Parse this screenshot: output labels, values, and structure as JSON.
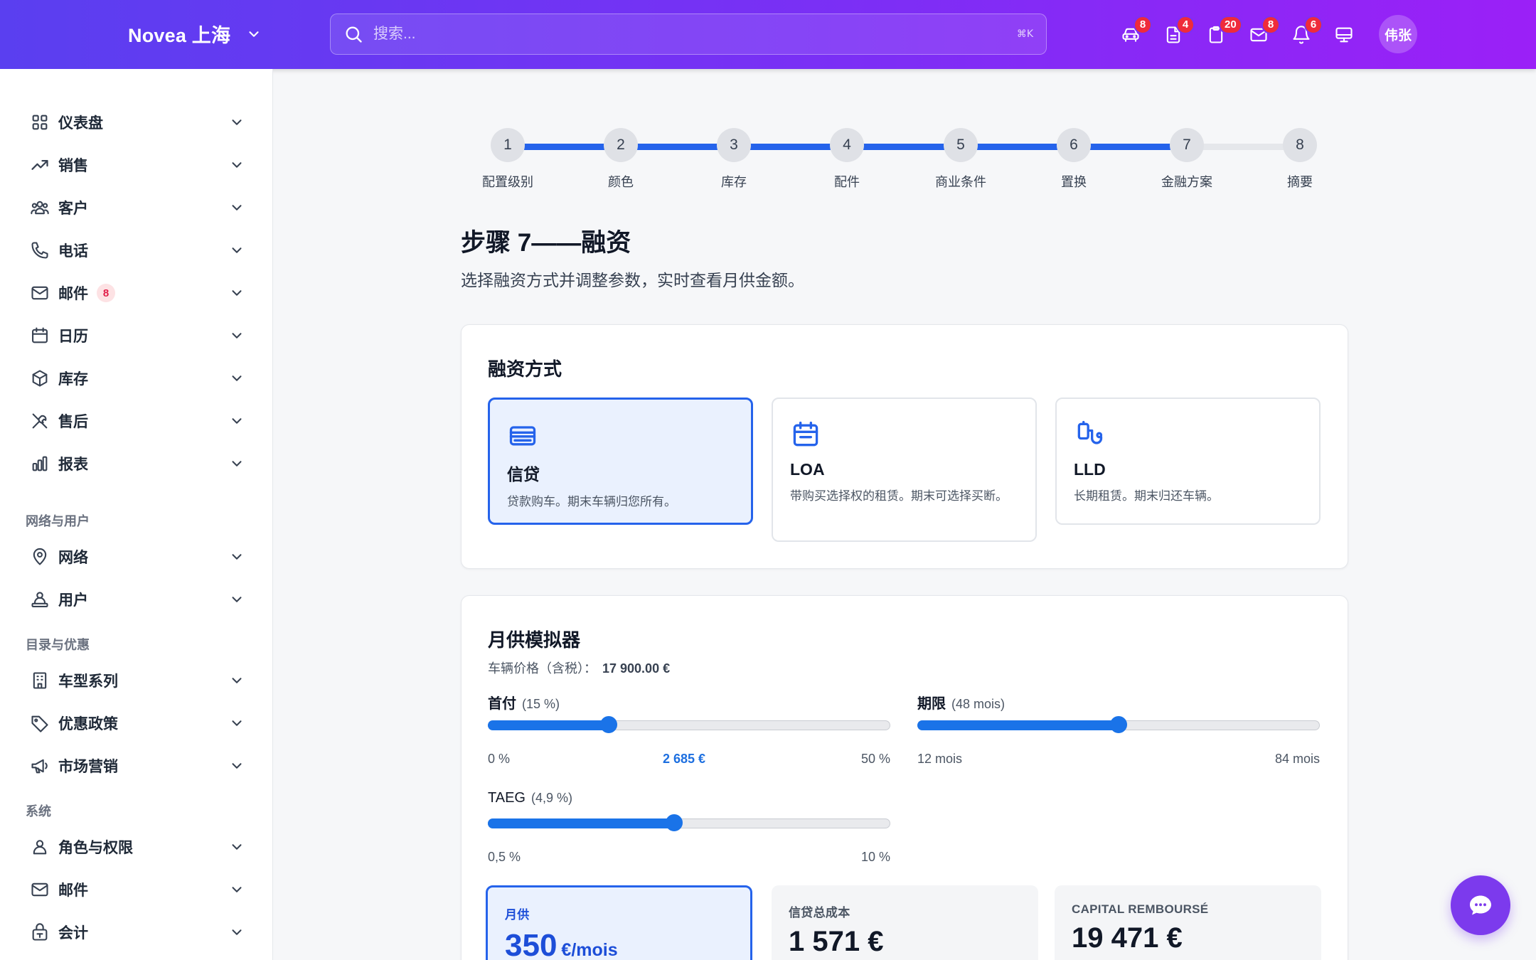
{
  "header": {
    "brand": "Novea 上海",
    "search_placeholder": "搜索...",
    "search_shortcut": "⌘K",
    "icons": [
      {
        "name": "car-icon",
        "badge": "8"
      },
      {
        "name": "document-icon",
        "badge": "4"
      },
      {
        "name": "clipboard-icon",
        "badge": "20"
      },
      {
        "name": "mail-icon",
        "badge": "8"
      },
      {
        "name": "bell-icon",
        "badge": "6"
      },
      {
        "name": "monitor-icon",
        "badge": ""
      }
    ],
    "avatar": "伟张"
  },
  "sidebar": {
    "items": [
      {
        "label": "仪表盘",
        "icon": "grid-icon"
      },
      {
        "label": "销售",
        "icon": "trending-up-icon"
      },
      {
        "label": "客户",
        "icon": "users-icon"
      },
      {
        "label": "电话",
        "icon": "phone-icon"
      },
      {
        "label": "邮件",
        "icon": "mail-icon",
        "badge": "8"
      },
      {
        "label": "日历",
        "icon": "calendar-icon"
      },
      {
        "label": "库存",
        "icon": "box-icon"
      },
      {
        "label": "售后",
        "icon": "tools-icon"
      },
      {
        "label": "报表",
        "icon": "bar-chart-icon"
      }
    ],
    "section_network": "网络与用户",
    "network_items": [
      {
        "label": "网络",
        "icon": "map-pin-icon"
      },
      {
        "label": "用户",
        "icon": "user-network-icon"
      }
    ],
    "section_catalog": "目录与优惠",
    "catalog_items": [
      {
        "label": "车型系列",
        "icon": "building-icon"
      },
      {
        "label": "优惠政策",
        "icon": "tag-icon"
      },
      {
        "label": "市场营销",
        "icon": "megaphone-icon"
      }
    ],
    "section_system": "系统",
    "system_items": [
      {
        "label": "角色与权限",
        "icon": "user-icon"
      },
      {
        "label": "邮件",
        "icon": "mail-icon"
      },
      {
        "label": "会计",
        "icon": "lock-box-icon"
      }
    ]
  },
  "stepper": {
    "current": 7,
    "steps": [
      {
        "num": "1",
        "label": "配置级别"
      },
      {
        "num": "2",
        "label": "颜色"
      },
      {
        "num": "3",
        "label": "库存"
      },
      {
        "num": "4",
        "label": "配件"
      },
      {
        "num": "5",
        "label": "商业条件"
      },
      {
        "num": "6",
        "label": "置换"
      },
      {
        "num": "7",
        "label": "金融方案"
      },
      {
        "num": "8",
        "label": "摘要"
      }
    ]
  },
  "main": {
    "title": "步骤 7——融资",
    "subtitle": "选择融资方式并调整参数，实时查看月供金额。"
  },
  "financing": {
    "title": "融资方式",
    "options": [
      {
        "name": "信贷",
        "desc": "贷款购车。期末车辆归您所有。",
        "icon": "card-icon",
        "selected": true
      },
      {
        "name": "LOA",
        "desc": "带购买选择权的租赁。期末可选择买断。",
        "icon": "calendar-icon",
        "selected": false
      },
      {
        "name": "LLD",
        "desc": "长期租赁。期末归还车辆。",
        "icon": "key-icon",
        "selected": false
      }
    ]
  },
  "simulator": {
    "title": "月供模拟器",
    "price_label": "车辆价格（含税）：",
    "price_value": "17 900.00 €",
    "down_payment": {
      "label": "首付",
      "value_text": "(15 %)",
      "fraction": 0.3,
      "min": "0 %",
      "max": "50 %",
      "amount": "2 685 €"
    },
    "term": {
      "label": "期限",
      "value_text": "(48 mois)",
      "fraction": 0.5,
      "min": "12 mois",
      "max": "84 mois"
    },
    "taeg": {
      "label": "TAEG",
      "value_text": "(4,9 %)",
      "fraction": 0.463,
      "min": "0,5 %",
      "max": "10 %"
    },
    "stats": [
      {
        "label": "月供",
        "value": "350",
        "unit": "€/mois"
      },
      {
        "label": "信贷总成本",
        "value": "1 571 €"
      },
      {
        "label": "CAPITAL REMBOURSÉ",
        "value": "19 471 €"
      }
    ]
  },
  "colors": {
    "accent": "#2563eb",
    "header_start": "#5a3ff0",
    "header_end": "#9b20f7",
    "fab": "#7c3aed"
  }
}
